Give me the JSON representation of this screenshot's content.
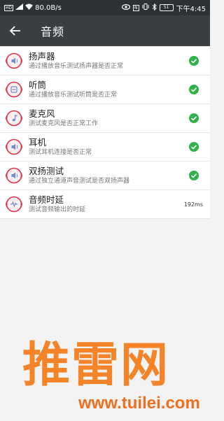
{
  "status_bar": {
    "left_tag": "HD",
    "signal_icon": "signal-icon",
    "wifi_icon": "wifi-icon",
    "net_speed": "80.0B/s",
    "eye_icon": "eye-icon",
    "nfc_label": "N",
    "vibrate_icon": "vibrate-icon",
    "bluetooth_icon": "bluetooth-icon",
    "battery_level": "51",
    "time": "下午4:45"
  },
  "app_bar": {
    "back_icon": "arrow-back-icon",
    "title": "音频"
  },
  "colors": {
    "status_bar_bg": "#2e3134",
    "app_bar_bg": "#3a3e43",
    "check_green": "#2fb24a",
    "icon_red": "#e0334b",
    "icon_blue": "#6a8fd8",
    "watermark_orange": "#f58428"
  },
  "items": [
    {
      "title": "扬声器",
      "subtitle": "通过播放音乐测试扬声器是否正常",
      "status": "check-circle-icon",
      "value": ""
    },
    {
      "title": "听筒",
      "subtitle": "通过播放音乐测试听筒是否正常",
      "status": "check-circle-icon",
      "value": ""
    },
    {
      "title": "麦克风",
      "subtitle": "测试麦克风是否正常工作",
      "status": "check-circle-icon",
      "value": ""
    },
    {
      "title": "耳机",
      "subtitle": "测试耳机连接是否正常",
      "status": "check-circle-icon",
      "value": ""
    },
    {
      "title": "双扬测试",
      "subtitle": "通过独立通道声音测试是否双扬声器",
      "status": "check-circle-icon",
      "value": ""
    },
    {
      "title": "音频时延",
      "subtitle": "测试音频输出的时延",
      "status": "",
      "value": "192ms"
    }
  ],
  "watermark": {
    "brand": "推雷网",
    "url": "www.tuilei.com"
  }
}
